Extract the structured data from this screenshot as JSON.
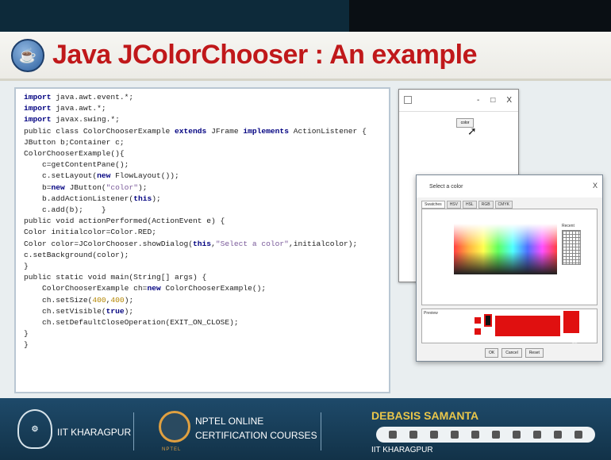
{
  "header": {
    "title": "Java JColorChooser : An example",
    "logo_icon": "java-cup-icon"
  },
  "code": {
    "lines": [
      [
        {
          "t": "import",
          "c": "kw"
        },
        {
          "t": " java.awt.event.*;",
          "c": "cl"
        }
      ],
      [
        {
          "t": "import",
          "c": "kw"
        },
        {
          "t": " java.awt.*;",
          "c": "cl"
        }
      ],
      [
        {
          "t": "import",
          "c": "kw"
        },
        {
          "t": " javax.swing.*;",
          "c": "cl"
        }
      ],
      [
        {
          "t": "public class ColorChooserExample ",
          "c": "cl"
        },
        {
          "t": "extends",
          "c": "kw"
        },
        {
          "t": " JFrame ",
          "c": "cl"
        },
        {
          "t": "implements",
          "c": "kw"
        },
        {
          "t": " ActionListener {",
          "c": "cl"
        }
      ],
      [
        {
          "t": "JButton b;Container c;",
          "c": "cl"
        }
      ],
      [
        {
          "t": "ColorChooserExample(){",
          "c": "cl"
        }
      ],
      [
        {
          "t": "    c=getContentPane();",
          "c": "cl"
        }
      ],
      [
        {
          "t": "    c.setLayout(",
          "c": "cl"
        },
        {
          "t": "new",
          "c": "kw"
        },
        {
          "t": " FlowLayout());",
          "c": "cl"
        }
      ],
      [
        {
          "t": "    b=",
          "c": "cl"
        },
        {
          "t": "new",
          "c": "kw"
        },
        {
          "t": " JButton(",
          "c": "cl"
        },
        {
          "t": "\"color\"",
          "c": "str"
        },
        {
          "t": ");",
          "c": "cl"
        }
      ],
      [
        {
          "t": "    b.addActionListener(",
          "c": "cl"
        },
        {
          "t": "this",
          "c": "kw"
        },
        {
          "t": ");",
          "c": "cl"
        }
      ],
      [
        {
          "t": "    c.add(b);    }",
          "c": "cl"
        }
      ],
      [
        {
          "t": "public void actionPerformed(ActionEvent e) {",
          "c": "cl"
        }
      ],
      [
        {
          "t": "Color initialcolor=Color.RED;",
          "c": "cl"
        }
      ],
      [
        {
          "t": "Color color=JColorChooser.showDialog(",
          "c": "cl"
        },
        {
          "t": "this",
          "c": "kw"
        },
        {
          "t": ",",
          "c": "cl"
        },
        {
          "t": "\"Select a color\"",
          "c": "str"
        },
        {
          "t": ",initialcolor);",
          "c": "cl"
        }
      ],
      [
        {
          "t": "c.setBackground(color);",
          "c": "cl"
        }
      ],
      [
        {
          "t": "}",
          "c": "cl"
        }
      ],
      [
        {
          "t": "public static void main(String[] args) {",
          "c": "cl"
        }
      ],
      [
        {
          "t": "    ColorChooserExample ch=",
          "c": "cl"
        },
        {
          "t": "new",
          "c": "kw"
        },
        {
          "t": " ColorChooserExample();",
          "c": "cl"
        }
      ],
      [
        {
          "t": "    ch.setSize(",
          "c": "cl"
        },
        {
          "t": "400",
          "c": "num"
        },
        {
          "t": ",",
          "c": "cl"
        },
        {
          "t": "400",
          "c": "num"
        },
        {
          "t": ");",
          "c": "cl"
        }
      ],
      [
        {
          "t": "    ch.setVisible(",
          "c": "cl"
        },
        {
          "t": "true",
          "c": "kw"
        },
        {
          "t": ");",
          "c": "cl"
        }
      ],
      [
        {
          "t": "    ch.setDefaultCloseOperation(EXIT_ON_CLOSE);",
          "c": "cl"
        }
      ],
      [
        {
          "t": "}",
          "c": "cl"
        }
      ],
      [
        {
          "t": "}",
          "c": "cl"
        }
      ]
    ]
  },
  "frame": {
    "button_label": "color",
    "min_icon": "-",
    "max_icon": "□",
    "close_icon": "X"
  },
  "dialog": {
    "title": "Select a color",
    "close": "X",
    "tabs": [
      "Swatches",
      "HSV",
      "HSL",
      "RGB",
      "CMYK"
    ],
    "recent_label": "Recent",
    "preview_label": "Preview",
    "sample_text": "Sample Text  Sample Text",
    "buttons": [
      "OK",
      "Cancel",
      "Reset"
    ]
  },
  "footer": {
    "institute": "IIT KHARAGPUR",
    "nptel_line1": "NPTEL ONLINE",
    "nptel_line2": "CERTIFICATION COURSES",
    "nptel_sub": "NPTEL",
    "speaker": "DEBASIS SAMANTA",
    "speaker_institute": "IIT KHARAGPUR"
  },
  "colors": {
    "title_red": "#c0181a",
    "keyword_blue": "#000080",
    "footer_blue": "#1e4a6a",
    "speaker_gold": "#e9c64a"
  }
}
